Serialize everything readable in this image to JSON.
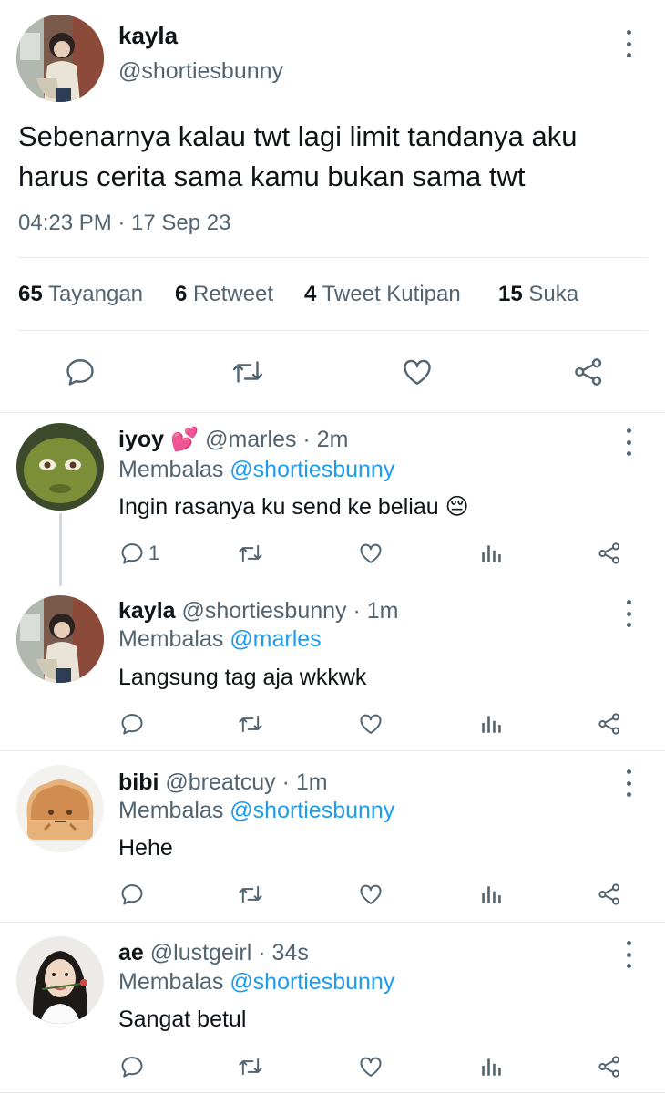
{
  "main_tweet": {
    "name": "kayla",
    "handle": "@shortiesbunny",
    "text": "Sebenarnya kalau twt lagi limit tandanya  aku harus cerita sama kamu bukan sama twt",
    "timestamp": "04:23 PM · 17 Sep 23",
    "stats": {
      "views_count": "65",
      "views_label": "Tayangan",
      "retweets_count": "6",
      "retweets_label": "Retweet",
      "quotes_count": "4",
      "quotes_label": "Tweet Kutipan",
      "likes_count": "15",
      "likes_label": "Suka"
    },
    "actions": [
      "reply-icon",
      "retweet-icon",
      "heart-icon",
      "share-icon"
    ]
  },
  "replies": [
    {
      "name": "iyoy",
      "emoji": "💕",
      "handle": "@marles",
      "time": "· 2m",
      "replying_label": "Membalas",
      "replying_to": "@shortiesbunny",
      "text": "Ingin rasanya ku send ke beliau 😔",
      "reply_count": "1"
    },
    {
      "name": "kayla",
      "handle": "@shortiesbunny",
      "time": "· 1m",
      "replying_label": "Membalas",
      "replying_to": "@marles",
      "text": "Langsung tag aja wkkwk",
      "reply_count": ""
    },
    {
      "name": "bibi",
      "handle": "@breatcuy",
      "time": "· 1m",
      "replying_label": "Membalas",
      "replying_to": "@shortiesbunny",
      "text": "Hehe",
      "reply_count": ""
    },
    {
      "name": "ae",
      "handle": "@lustgeirl",
      "time": "· 34s",
      "replying_label": "Membalas",
      "replying_to": "@shortiesbunny",
      "text": "Sangat betul",
      "reply_count": ""
    }
  ],
  "colors": {
    "text": "#0f1419",
    "secondary": "#536471",
    "link": "#1d9bf0",
    "divider": "#e6e9ec"
  }
}
